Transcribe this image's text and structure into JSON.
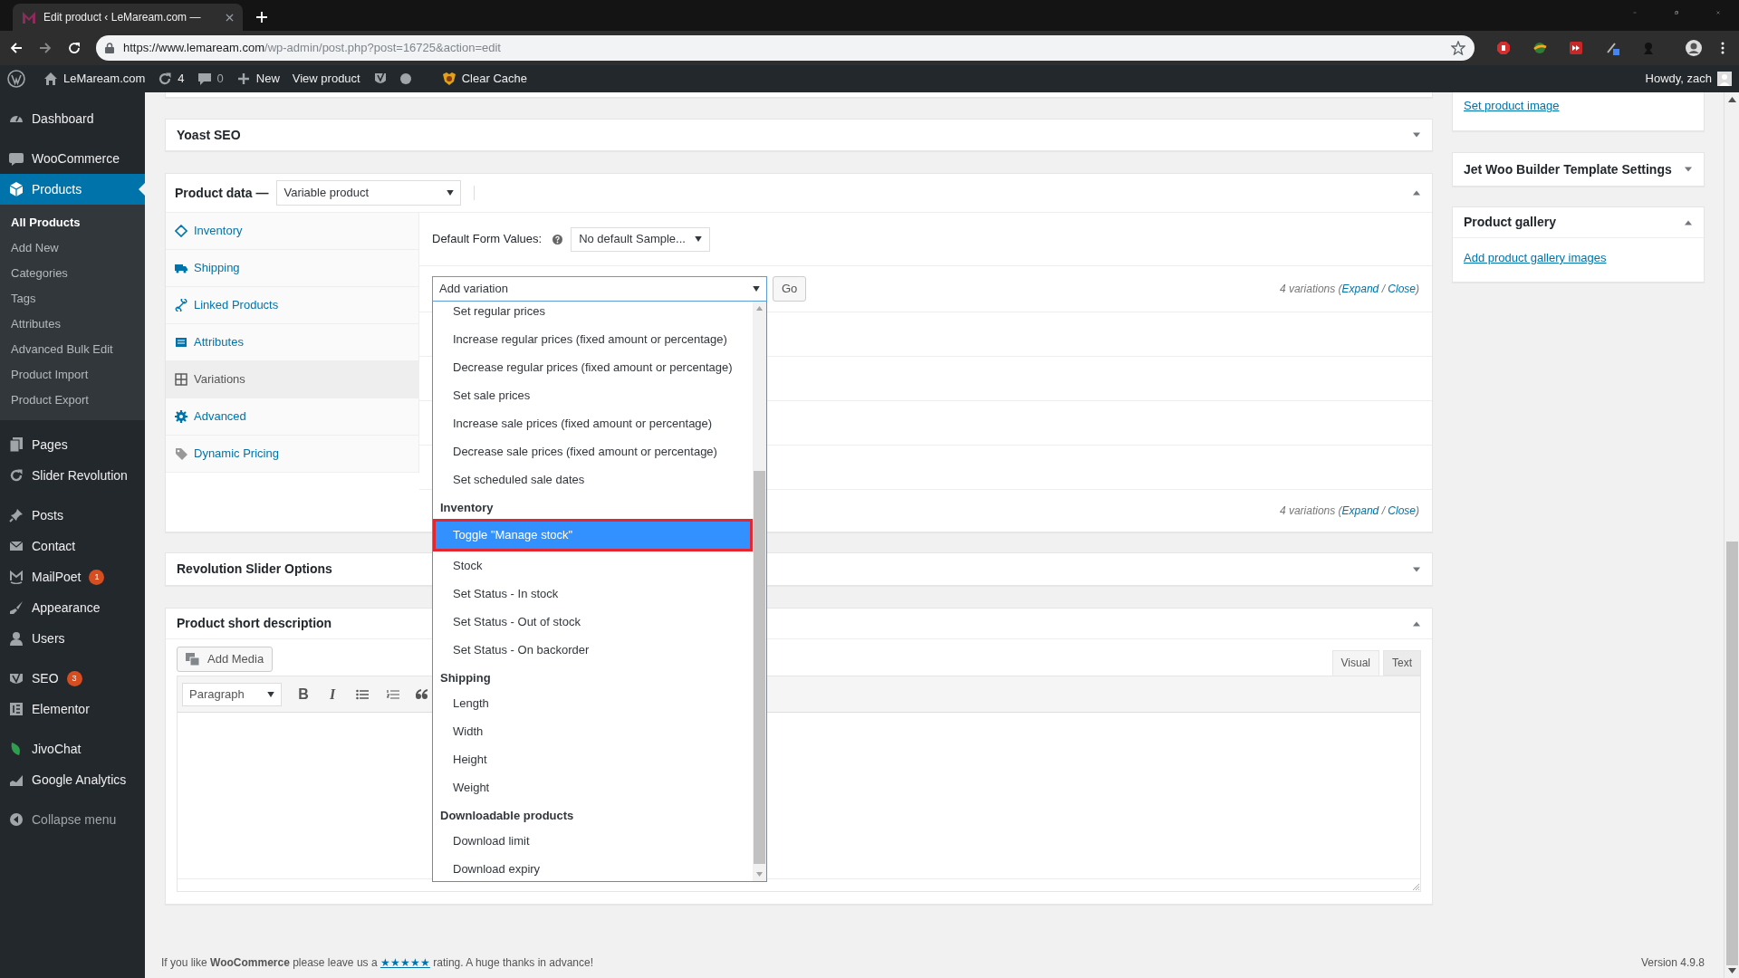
{
  "browser": {
    "tab_title": "Edit product ‹ LeMaream.com —",
    "url_host": "https://www.lemaream.com",
    "url_path": "/wp-admin/post.php?post=16725&action=edit"
  },
  "admin_bar": {
    "site": "LeMaream.com",
    "updates": "4",
    "comments": "0",
    "new": "New",
    "view": "View product",
    "clear_cache": "Clear Cache",
    "greeting": "Howdy, zach"
  },
  "sidebar": {
    "groups": [
      {
        "items": [
          {
            "label": "Dashboard",
            "selected": false
          }
        ]
      },
      {
        "items": [
          {
            "label": "WooCommerce",
            "selected": false
          },
          {
            "label": "Products",
            "selected": true,
            "children": [
              {
                "label": "All Products",
                "selected": true
              },
              {
                "label": "Add New",
                "selected": false
              },
              {
                "label": "Categories",
                "selected": false
              },
              {
                "label": "Tags",
                "selected": false
              },
              {
                "label": "Attributes",
                "selected": false
              },
              {
                "label": "Advanced Bulk Edit",
                "selected": false
              },
              {
                "label": "Product Import",
                "selected": false
              },
              {
                "label": "Product Export",
                "selected": false
              }
            ]
          }
        ]
      },
      {
        "items": [
          {
            "label": "Pages",
            "selected": false
          },
          {
            "label": "Slider Revolution",
            "selected": false
          }
        ]
      },
      {
        "items": [
          {
            "label": "Posts",
            "selected": false
          },
          {
            "label": "Contact",
            "selected": false
          },
          {
            "label": "MailPoet",
            "selected": false,
            "badge": "1"
          },
          {
            "label": "Appearance",
            "selected": false
          },
          {
            "label": "Users",
            "selected": false
          }
        ]
      },
      {
        "items": [
          {
            "label": "SEO",
            "selected": false,
            "badge": "3"
          },
          {
            "label": "Elementor",
            "selected": false
          }
        ]
      },
      {
        "items": [
          {
            "label": "JivoChat",
            "selected": false
          },
          {
            "label": "Google Analytics",
            "selected": false
          }
        ]
      }
    ],
    "collapse": "Collapse menu"
  },
  "yoast_box": {
    "title": "Yoast SEO",
    "expanded": false
  },
  "product_data": {
    "title": "Product data —",
    "type": "Variable product",
    "expanded": true,
    "tabs": [
      {
        "label": "Inventory",
        "selected": false
      },
      {
        "label": "Shipping",
        "selected": false
      },
      {
        "label": "Linked Products",
        "selected": false
      },
      {
        "label": "Attributes",
        "selected": false
      },
      {
        "label": "Variations",
        "selected": true
      },
      {
        "label": "Advanced",
        "selected": false
      },
      {
        "label": "Dynamic Pricing",
        "selected": false
      }
    ],
    "default_label": "Default Form Values:",
    "default_value": "No default Sample...",
    "action_value": "Add variation",
    "go": "Go",
    "summary_top": [
      {
        "text": "4 variations (",
        "link": false
      },
      {
        "text": "Expand",
        "link": true
      },
      {
        "text": " / ",
        "link": false
      },
      {
        "text": "Close",
        "link": true
      },
      {
        "text": ")",
        "link": false
      }
    ],
    "summary_bottom": [
      {
        "text": "4 variations (",
        "link": false
      },
      {
        "text": "Expand",
        "link": true
      },
      {
        "text": " / ",
        "link": false
      },
      {
        "text": "Close",
        "link": true
      },
      {
        "text": ")",
        "link": false
      }
    ],
    "options": [
      {
        "kind": "option",
        "label": "Set regular prices",
        "selected": false
      },
      {
        "kind": "option",
        "label": "Increase regular prices (fixed amount or percentage)",
        "selected": false
      },
      {
        "kind": "option",
        "label": "Decrease regular prices (fixed amount or percentage)",
        "selected": false
      },
      {
        "kind": "option",
        "label": "Set sale prices",
        "selected": false
      },
      {
        "kind": "option",
        "label": "Increase sale prices (fixed amount or percentage)",
        "selected": false
      },
      {
        "kind": "option",
        "label": "Decrease sale prices (fixed amount or percentage)",
        "selected": false
      },
      {
        "kind": "option",
        "label": "Set scheduled sale dates",
        "selected": false
      },
      {
        "kind": "group",
        "label": "Inventory"
      },
      {
        "kind": "option",
        "label": "Toggle \"Manage stock\"",
        "selected": true
      },
      {
        "kind": "option",
        "label": "Stock",
        "selected": false
      },
      {
        "kind": "option",
        "label": "Set Status - In stock",
        "selected": false
      },
      {
        "kind": "option",
        "label": "Set Status - Out of stock",
        "selected": false
      },
      {
        "kind": "option",
        "label": "Set Status - On backorder",
        "selected": false
      },
      {
        "kind": "group",
        "label": "Shipping"
      },
      {
        "kind": "option",
        "label": "Length",
        "selected": false
      },
      {
        "kind": "option",
        "label": "Width",
        "selected": false
      },
      {
        "kind": "option",
        "label": "Height",
        "selected": false
      },
      {
        "kind": "option",
        "label": "Weight",
        "selected": false
      },
      {
        "kind": "group",
        "label": "Downloadable products"
      },
      {
        "kind": "option",
        "label": "Download limit",
        "selected": false
      },
      {
        "kind": "option",
        "label": "Download expiry",
        "selected": false
      }
    ]
  },
  "revslider_box": {
    "title": "Revolution Slider Options",
    "expanded": false
  },
  "short_description": {
    "title": "Product short description",
    "expanded": true,
    "add_media": "Add Media",
    "format": "Paragraph",
    "bold": "B",
    "italic": "I",
    "tabs": [
      {
        "label": "Visual",
        "selected": true
      },
      {
        "label": "Text",
        "selected": false
      }
    ]
  },
  "side": {
    "image_link": "Set product image",
    "jet_box": {
      "title": "Jet Woo Builder Template Settings",
      "expanded": false
    },
    "gallery_box": {
      "title": "Product gallery",
      "expanded": true,
      "link": "Add product gallery images"
    }
  },
  "footer": {
    "parts": [
      {
        "text": "If you like **WooCommerce** please leave us a ",
        "link": false
      },
      {
        "text": "★★★★★",
        "link": true
      },
      {
        "text": " rating. A huge thanks in advance!",
        "link": false
      }
    ],
    "version": "Version 4.9.8"
  }
}
